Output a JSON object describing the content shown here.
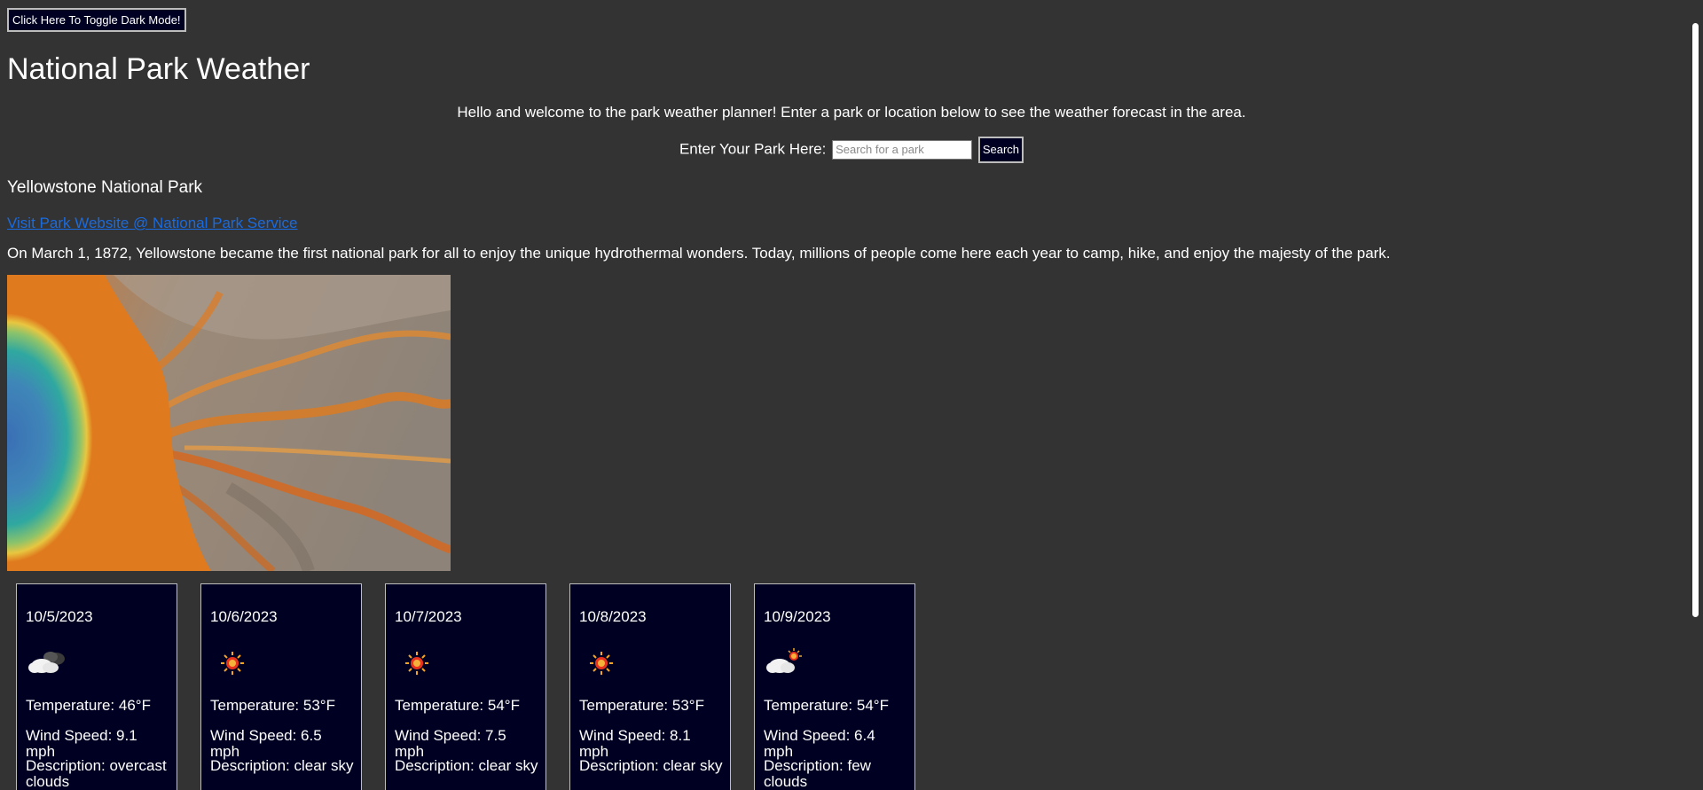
{
  "header": {
    "toggle_label": "Click Here To Toggle Dark Mode!",
    "title": "National Park Weather",
    "welcome": "Hello and welcome to the park weather planner! Enter a park or location below to see the weather forecast in the area."
  },
  "search": {
    "label": "Enter Your Park Here:",
    "placeholder": "Search for a park",
    "value": "",
    "button_label": "Search"
  },
  "park": {
    "name": "Yellowstone National Park",
    "link_text": "Visit Park Website @ National Park Service",
    "description": "On March 1, 1872, Yellowstone became the first national park for all to enjoy the unique hydrothermal wonders. Today, millions of people come here each year to camp, hike, and enjoy the majesty of the park."
  },
  "forecast": [
    {
      "date": "10/5/2023",
      "icon": "overcast-clouds-icon",
      "temperature": "Temperature: 46°F",
      "wind": "Wind Speed: 9.1 mph",
      "description": "Description: overcast clouds"
    },
    {
      "date": "10/6/2023",
      "icon": "sun-icon",
      "temperature": "Temperature: 53°F",
      "wind": "Wind Speed: 6.5 mph",
      "description": "Description: clear sky"
    },
    {
      "date": "10/7/2023",
      "icon": "sun-icon",
      "temperature": "Temperature: 54°F",
      "wind": "Wind Speed: 7.5 mph",
      "description": "Description: clear sky"
    },
    {
      "date": "10/8/2023",
      "icon": "sun-icon",
      "temperature": "Temperature: 53°F",
      "wind": "Wind Speed: 8.1 mph",
      "description": "Description: clear sky"
    },
    {
      "date": "10/9/2023",
      "icon": "few-clouds-icon",
      "temperature": "Temperature: 54°F",
      "wind": "Wind Speed: 6.4 mph",
      "description": "Description: few clouds"
    }
  ],
  "colors": {
    "background": "#333333",
    "card_background": "#000022",
    "link": "#1a6be0"
  }
}
